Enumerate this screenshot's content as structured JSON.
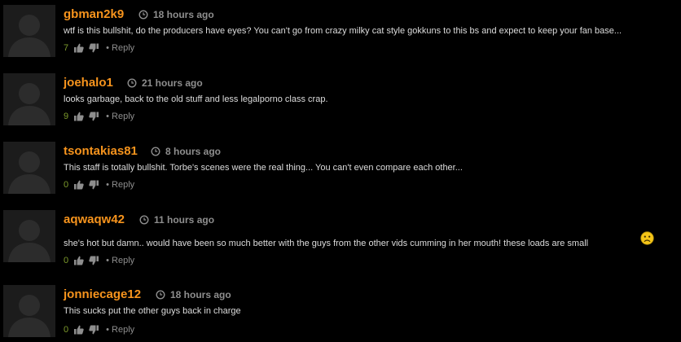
{
  "comments": [
    {
      "author": "gbman2k9",
      "time": "18 hours ago",
      "text": "wtf is this bullshit, do the producers have eyes? You can't go from crazy milky cat style gokkuns to this bs and expect to keep your fan base...",
      "votes": "7",
      "reply_label": "• Reply",
      "has_emoji": false
    },
    {
      "author": "joehalo1",
      "time": "21 hours ago",
      "text": "looks garbage, back to the old stuff and less legalporno class crap.",
      "votes": "9",
      "reply_label": "• Reply",
      "has_emoji": false
    },
    {
      "author": "tsontakias81",
      "time": "8 hours ago",
      "text": "This staff is totally bullshit. Torbe's scenes were the real thing... You can't even compare each other...",
      "votes": "0",
      "reply_label": "• Reply",
      "has_emoji": false
    },
    {
      "author": "aqwaqw42",
      "time": "11 hours ago",
      "text": "she's hot but damn.. would have been so much better with the guys from the other vids cumming in her mouth! these loads are small",
      "votes": "0",
      "reply_label": "• Reply",
      "has_emoji": true,
      "emoji_icon": "sad-face-icon"
    },
    {
      "author": "jonniecage12",
      "time": "18 hours ago",
      "text": "This sucks put the other guys back in charge",
      "votes": "0",
      "reply_label": "• Reply",
      "has_emoji": false
    }
  ],
  "icons": {
    "avatar": "default-avatar-silhouette-icon",
    "clock": "clock-icon",
    "upvote": "thumbs-up-icon",
    "downvote": "thumbs-down-icon"
  },
  "colors": {
    "background": "#000000",
    "author": "#f7941d",
    "timestamp": "#8e8e8e",
    "text": "#dcdcdc",
    "votes": "#7d9b2c",
    "avatar_bg": "#1c1c1c",
    "avatar_figure": "#2c2c2c"
  }
}
